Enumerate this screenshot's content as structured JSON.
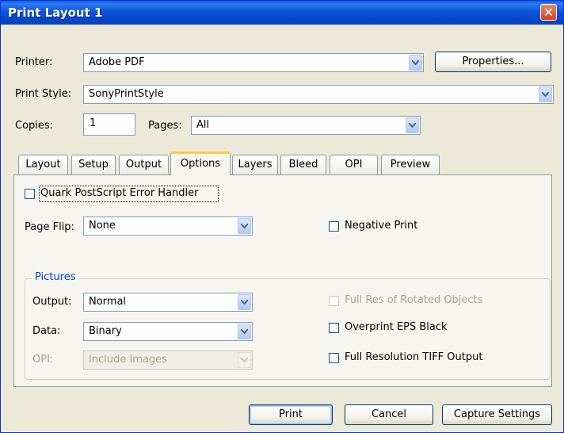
{
  "window": {
    "title": "Print Layout 1",
    "close_icon": "close-icon"
  },
  "printer": {
    "label": "Printer:",
    "value": "Adobe PDF",
    "properties_label": "Properties..."
  },
  "print_style": {
    "label": "Print Style:",
    "value": "SonyPrintStyle"
  },
  "copies": {
    "label": "Copies:",
    "value": "1"
  },
  "pages": {
    "label": "Pages:",
    "value": "All"
  },
  "tabs": [
    {
      "label": "Layout"
    },
    {
      "label": "Setup"
    },
    {
      "label": "Output"
    },
    {
      "label": "Options",
      "active": true
    },
    {
      "label": "Layers"
    },
    {
      "label": "Bleed"
    },
    {
      "label": "OPI"
    },
    {
      "label": "Preview"
    }
  ],
  "options": {
    "quark_error_handler": {
      "label": "Quark PostScript Error Handler",
      "checked": false
    },
    "page_flip": {
      "label": "Page Flip:",
      "value": "None"
    },
    "negative_print": {
      "label": "Negative Print",
      "checked": false
    },
    "pictures": {
      "title": "Pictures",
      "output": {
        "label": "Output:",
        "value": "Normal"
      },
      "data": {
        "label": "Data:",
        "value": "Binary"
      },
      "opi": {
        "label": "OPI:",
        "value": "Include Images",
        "disabled": true
      },
      "full_res_rotated": {
        "label": "Full Res of Rotated Objects",
        "checked": false,
        "disabled": true
      },
      "overprint_eps_black": {
        "label": "Overprint EPS Black",
        "checked": false
      },
      "full_res_tiff": {
        "label": "Full Resolution TIFF Output",
        "checked": false
      }
    }
  },
  "buttons": {
    "print": "Print",
    "cancel": "Cancel",
    "capture": "Capture Settings"
  },
  "colors": {
    "titlebar": "#0a55d8",
    "dialog_bg": "#ece9d8",
    "group_title": "#0046d5",
    "active_tab_accent": "#ffc83c"
  }
}
